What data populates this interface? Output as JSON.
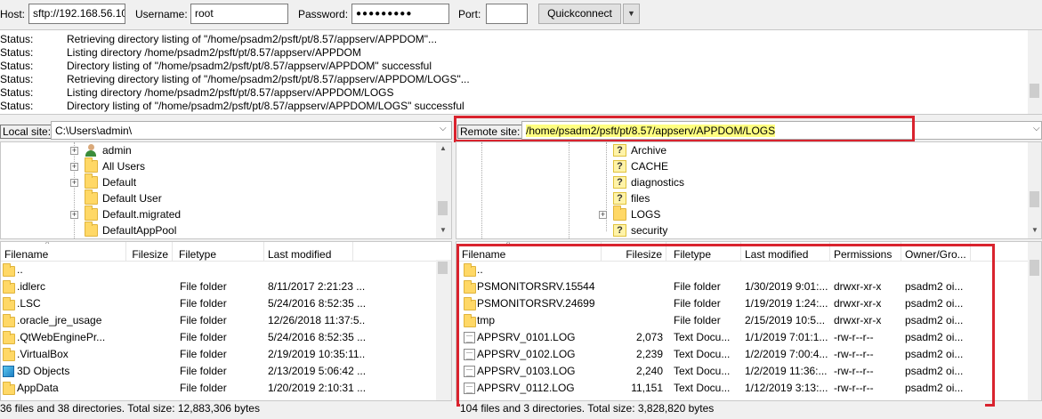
{
  "quickconnect": {
    "host_label": "Host:",
    "host_value": "sftp://192.168.56.10",
    "username_label": "Username:",
    "username_value": "root",
    "password_label": "Password:",
    "password_value": "●●●●●●●●●",
    "port_label": "Port:",
    "port_value": "",
    "connect_label": "Quickconnect",
    "dropdown_icon": "▼"
  },
  "log": [
    {
      "tag": "Status:",
      "msg": "Retrieving directory listing of \"/home/psadm2/psft/pt/8.57/appserv/APPDOM\"..."
    },
    {
      "tag": "Status:",
      "msg": "Listing directory /home/psadm2/psft/pt/8.57/appserv/APPDOM"
    },
    {
      "tag": "Status:",
      "msg": "Directory listing of \"/home/psadm2/psft/pt/8.57/appserv/APPDOM\" successful"
    },
    {
      "tag": "Status:",
      "msg": "Retrieving directory listing of \"/home/psadm2/psft/pt/8.57/appserv/APPDOM/LOGS\"..."
    },
    {
      "tag": "Status:",
      "msg": "Listing directory /home/psadm2/psft/pt/8.57/appserv/APPDOM/LOGS"
    },
    {
      "tag": "Status:",
      "msg": "Directory listing of \"/home/psadm2/psft/pt/8.57/appserv/APPDOM/LOGS\" successful"
    }
  ],
  "local": {
    "site_label": "Local site:",
    "site_path": "C:\\Users\\admin\\",
    "tree": [
      {
        "name": "admin",
        "icon": "user-icon",
        "expander": "+"
      },
      {
        "name": "All Users",
        "icon": "folder-icon",
        "expander": "+"
      },
      {
        "name": "Default",
        "icon": "folder-icon",
        "expander": "+"
      },
      {
        "name": "Default User",
        "icon": "folder-icon",
        "expander": ""
      },
      {
        "name": "Default.migrated",
        "icon": "folder-icon",
        "expander": "+"
      },
      {
        "name": "DefaultAppPool",
        "icon": "folder-icon",
        "expander": ""
      }
    ],
    "headers": [
      "Filename",
      "Filesize",
      "Filetype",
      "Last modified"
    ],
    "files": [
      {
        "name": "..",
        "size": "",
        "type": "",
        "modified": "",
        "icon": "folder-icon"
      },
      {
        "name": ".idlerc",
        "size": "",
        "type": "File folder",
        "modified": "8/11/2017 2:21:23 ...",
        "icon": "folder-icon"
      },
      {
        "name": ".LSC",
        "size": "",
        "type": "File folder",
        "modified": "5/24/2016 8:52:35 ...",
        "icon": "folder-icon"
      },
      {
        "name": ".oracle_jre_usage",
        "size": "",
        "type": "File folder",
        "modified": "12/26/2018 11:37:5...",
        "icon": "folder-icon"
      },
      {
        "name": ".QtWebEnginePr...",
        "size": "",
        "type": "File folder",
        "modified": "5/24/2016 8:52:35 ...",
        "icon": "folder-icon"
      },
      {
        "name": ".VirtualBox",
        "size": "",
        "type": "File folder",
        "modified": "2/19/2019 10:35:11...",
        "icon": "folder-icon"
      },
      {
        "name": "3D Objects",
        "size": "",
        "type": "File folder",
        "modified": "2/13/2019 5:06:42 ...",
        "icon": "3d-objects-icon"
      },
      {
        "name": "AppData",
        "size": "",
        "type": "File folder",
        "modified": "1/20/2019 2:10:31 ...",
        "icon": "folder-icon"
      }
    ],
    "status": "36 files and 38 directories. Total size: 12,883,306 bytes"
  },
  "remote": {
    "site_label": "Remote site:",
    "site_path": "/home/psadm2/psft/pt/8.57/appserv/APPDOM/LOGS",
    "tree": [
      {
        "name": "Archive",
        "icon": "unknown-folder-icon",
        "expander": ""
      },
      {
        "name": "CACHE",
        "icon": "unknown-folder-icon",
        "expander": ""
      },
      {
        "name": "diagnostics",
        "icon": "unknown-folder-icon",
        "expander": ""
      },
      {
        "name": "files",
        "icon": "unknown-folder-icon",
        "expander": ""
      },
      {
        "name": "LOGS",
        "icon": "folder-icon",
        "expander": "+"
      },
      {
        "name": "security",
        "icon": "unknown-folder-icon",
        "expander": ""
      }
    ],
    "headers": [
      "Filename",
      "Filesize",
      "Filetype",
      "Last modified",
      "Permissions",
      "Owner/Gro..."
    ],
    "files": [
      {
        "name": "..",
        "size": "",
        "type": "",
        "modified": "",
        "perms": "",
        "owner": "",
        "icon": "folder-icon"
      },
      {
        "name": "PSMONITORSRV.15544",
        "size": "",
        "type": "File folder",
        "modified": "1/30/2019 9:01:...",
        "perms": "drwxr-xr-x",
        "owner": "psadm2 oi...",
        "icon": "folder-icon"
      },
      {
        "name": "PSMONITORSRV.24699",
        "size": "",
        "type": "File folder",
        "modified": "1/19/2019 1:24:...",
        "perms": "drwxr-xr-x",
        "owner": "psadm2 oi...",
        "icon": "folder-icon"
      },
      {
        "name": "tmp",
        "size": "",
        "type": "File folder",
        "modified": "2/15/2019 10:5...",
        "perms": "drwxr-xr-x",
        "owner": "psadm2 oi...",
        "icon": "folder-icon"
      },
      {
        "name": "APPSRV_0101.LOG",
        "size": "2,073",
        "type": "Text Docu...",
        "modified": "1/1/2019 7:01:1...",
        "perms": "-rw-r--r--",
        "owner": "psadm2 oi...",
        "icon": "document-icon"
      },
      {
        "name": "APPSRV_0102.LOG",
        "size": "2,239",
        "type": "Text Docu...",
        "modified": "1/2/2019 7:00:4...",
        "perms": "-rw-r--r--",
        "owner": "psadm2 oi...",
        "icon": "document-icon"
      },
      {
        "name": "APPSRV_0103.LOG",
        "size": "2,240",
        "type": "Text Docu...",
        "modified": "1/2/2019 11:36:...",
        "perms": "-rw-r--r--",
        "owner": "psadm2 oi...",
        "icon": "document-icon"
      },
      {
        "name": "APPSRV_0112.LOG",
        "size": "11,151",
        "type": "Text Docu...",
        "modified": "1/12/2019 3:13:...",
        "perms": "-rw-r--r--",
        "owner": "psadm2 oi...",
        "icon": "document-icon"
      }
    ],
    "status": "104 files and 3 directories. Total size: 3,828,820 bytes"
  },
  "colors": {
    "highlight_box": "#d9232e",
    "path_highlight": "#ffff80",
    "folder": "#ffd866"
  }
}
